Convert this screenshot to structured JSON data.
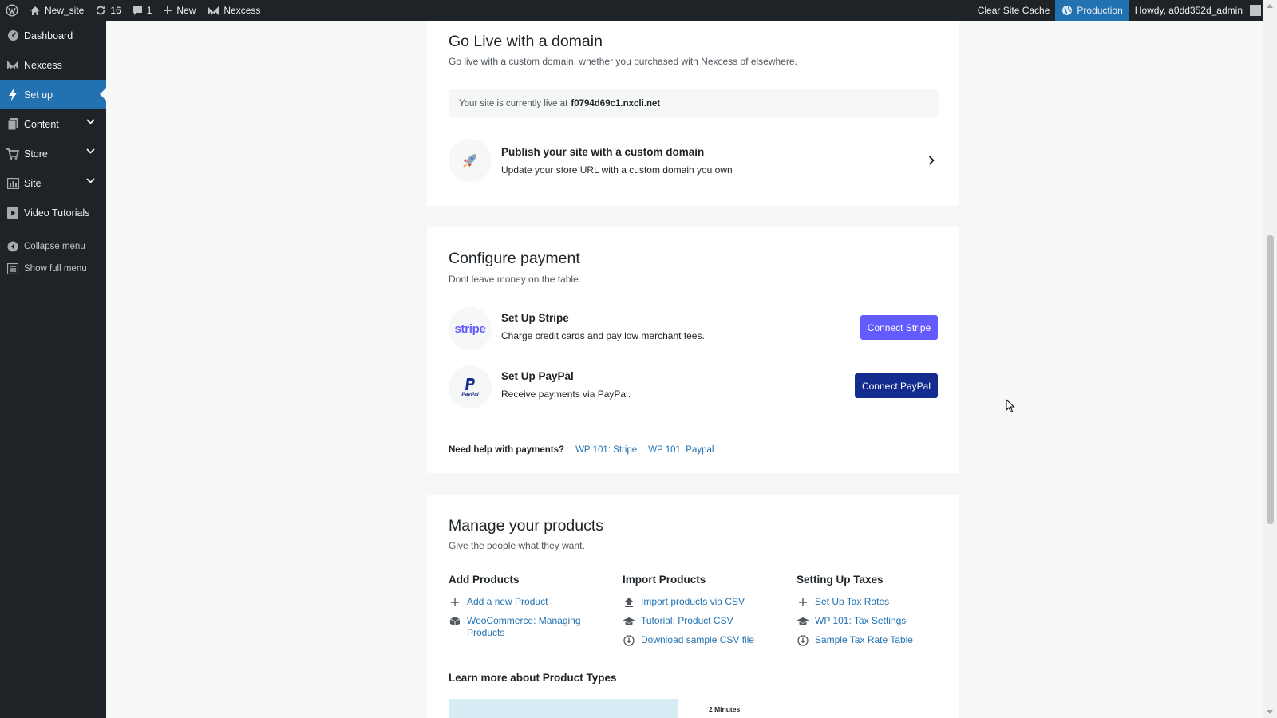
{
  "admin_bar": {
    "site_name": "New_site",
    "updates_count": "16",
    "comments_count": "1",
    "new_label": "New",
    "nexcess_label": "Nexcess",
    "clear_cache_label": "Clear Site Cache",
    "environment_label": "Production",
    "howdy_label": "Howdy, a0dd352d_admin"
  },
  "sidebar": {
    "items": [
      {
        "label": "Dashboard",
        "icon": "dashboard-icon"
      },
      {
        "label": "Nexcess",
        "icon": "nexcess-icon"
      },
      {
        "label": "Set up",
        "icon": "bolt-icon",
        "active": true
      },
      {
        "label": "Content",
        "icon": "pages-icon",
        "has_submenu": true
      },
      {
        "label": "Store",
        "icon": "cart-icon",
        "has_submenu": true
      },
      {
        "label": "Site",
        "icon": "chart-icon",
        "has_submenu": true
      },
      {
        "label": "Video Tutorials",
        "icon": "video-icon"
      }
    ],
    "collapse_label": "Collapse menu",
    "full_menu_label": "Show full menu"
  },
  "domain_card": {
    "title": "Go Live with a domain",
    "subtitle": "Go live with a custom domain, whether you purchased with Nexcess of elsewhere.",
    "live_prefix": "Your site is currently live at",
    "live_url": "f0794d69c1.nxcli.net",
    "publish_title": "Publish your site with a custom domain",
    "publish_desc": "Update your store URL with a custom domain you own"
  },
  "payment_card": {
    "title": "Configure payment",
    "subtitle": "Dont leave money on the table.",
    "stripe_logo": "stripe",
    "stripe_title": "Set Up Stripe",
    "stripe_desc": "Charge credit cards and pay low merchant fees.",
    "stripe_button": "Connect Stripe",
    "paypal_logo": "PayPal",
    "paypal_title": "Set Up PayPal",
    "paypal_desc": "Receive payments via PayPal.",
    "paypal_button": "Connect PayPal",
    "help_label": "Need help with payments?",
    "help_links": [
      "WP 101: Stripe",
      "WP 101: Paypal"
    ]
  },
  "products_card": {
    "title": "Manage your products",
    "subtitle": "Give the people what they want.",
    "columns": [
      {
        "heading": "Add Products",
        "items": [
          {
            "label": "Add a new Product",
            "icon": "plus-icon"
          },
          {
            "label": "WooCommerce: Managing Products",
            "icon": "box-icon"
          }
        ]
      },
      {
        "heading": "Import Products",
        "items": [
          {
            "label": "Import products via CSV",
            "icon": "upload-icon"
          },
          {
            "label": "Tutorial: Product CSV",
            "icon": "graduation-cap-icon"
          },
          {
            "label": "Download sample CSV file",
            "icon": "download-icon"
          }
        ]
      },
      {
        "heading": "Setting Up Taxes",
        "items": [
          {
            "label": "Set Up Tax Rates",
            "icon": "plus-icon"
          },
          {
            "label": "WP 101: Tax Settings",
            "icon": "graduation-cap-icon"
          },
          {
            "label": "Sample Tax Rate Table",
            "icon": "download-icon"
          }
        ]
      }
    ],
    "learn_heading": "Learn more about Product Types",
    "video_duration": "2 Minutes"
  },
  "colors": {
    "admin_dark": "#1d2327",
    "wp_blue": "#2271b1",
    "stripe_purple": "#635bff",
    "paypal_navy": "#142c8e",
    "page_bg": "#f6f7f7"
  }
}
